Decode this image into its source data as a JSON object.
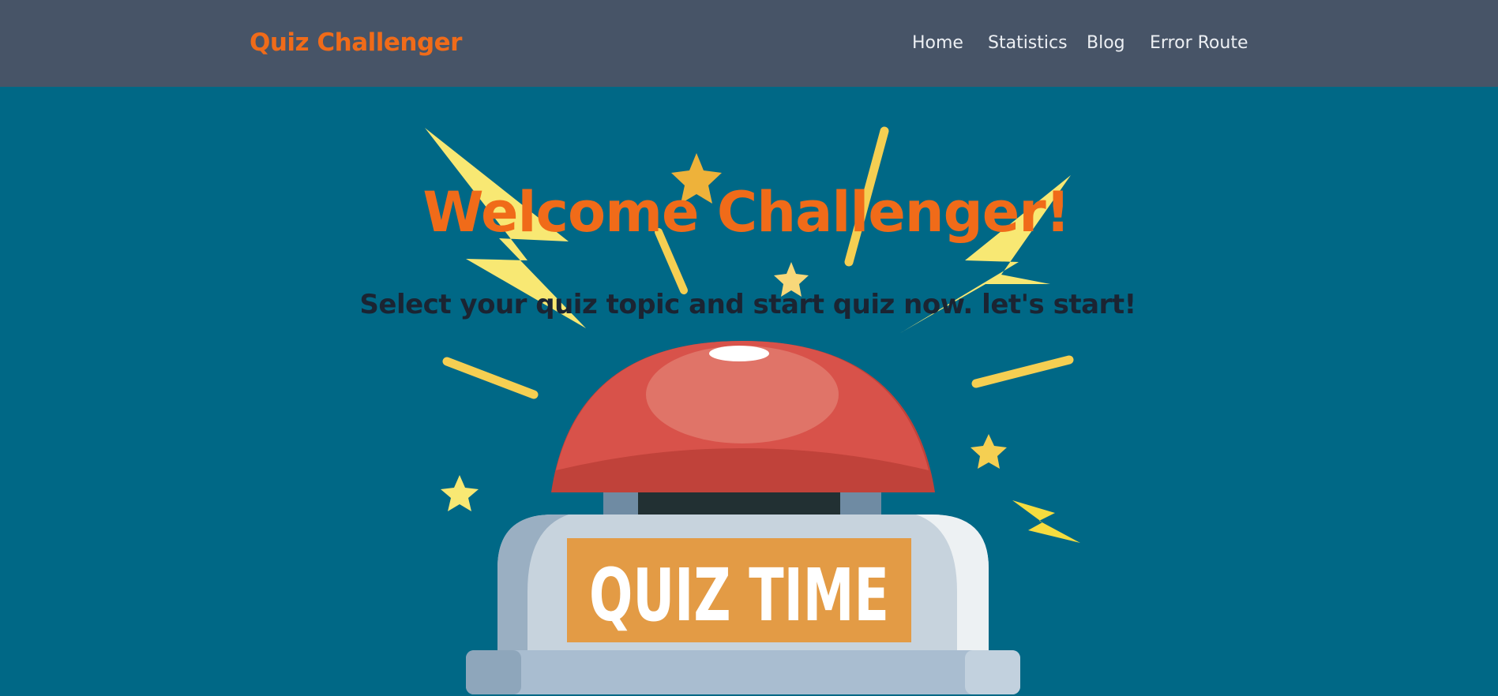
{
  "navbar": {
    "brand": "Quiz Challenger",
    "links": [
      {
        "label": "Home"
      },
      {
        "label": "Statistics"
      },
      {
        "label": "Blog"
      },
      {
        "label": "Error Route"
      }
    ]
  },
  "hero": {
    "title": "Welcome Challenger!",
    "subtitle": "Select your quiz topic and start quiz now. let's start!",
    "image": {
      "button_label": "QUIZ TIME",
      "icon": "quiz-time-buzzer-illustration"
    }
  },
  "colors": {
    "navbar_bg": "#475467",
    "page_bg": "#006886",
    "accent": "#f06b19",
    "subtitle": "#1b2432",
    "nav_link": "#eceff3"
  }
}
